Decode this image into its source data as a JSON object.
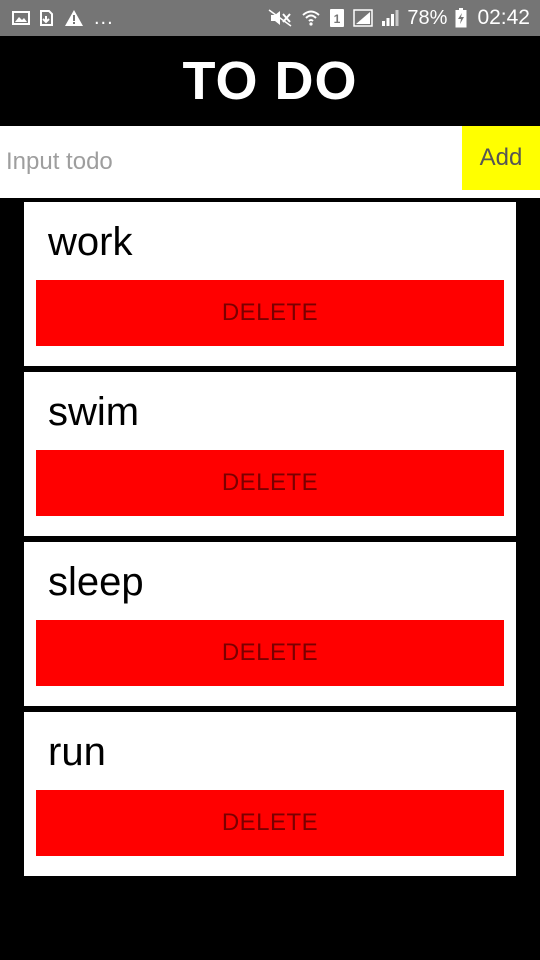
{
  "status_bar": {
    "left_icons": [
      "image-icon",
      "download-icon",
      "warning-icon"
    ],
    "overflow": "...",
    "right_icons": [
      "mute-icon",
      "wifi-icon",
      "sim1-icon",
      "signal-icon",
      "signal-icon"
    ],
    "battery": "78%",
    "time": "02:42"
  },
  "header": {
    "title": "TO DO"
  },
  "input": {
    "placeholder": "Input todo",
    "value": ""
  },
  "add_button": {
    "label": "Add"
  },
  "todos": [
    {
      "text": "work",
      "delete_label": "DELETE"
    },
    {
      "text": "swim",
      "delete_label": "DELETE"
    },
    {
      "text": "sleep",
      "delete_label": "DELETE"
    },
    {
      "text": "run",
      "delete_label": "DELETE"
    }
  ],
  "colors": {
    "background": "#000000",
    "status_bar": "#757575",
    "add_button": "#ffff00",
    "delete_button": "#ff0000",
    "card": "#ffffff"
  }
}
